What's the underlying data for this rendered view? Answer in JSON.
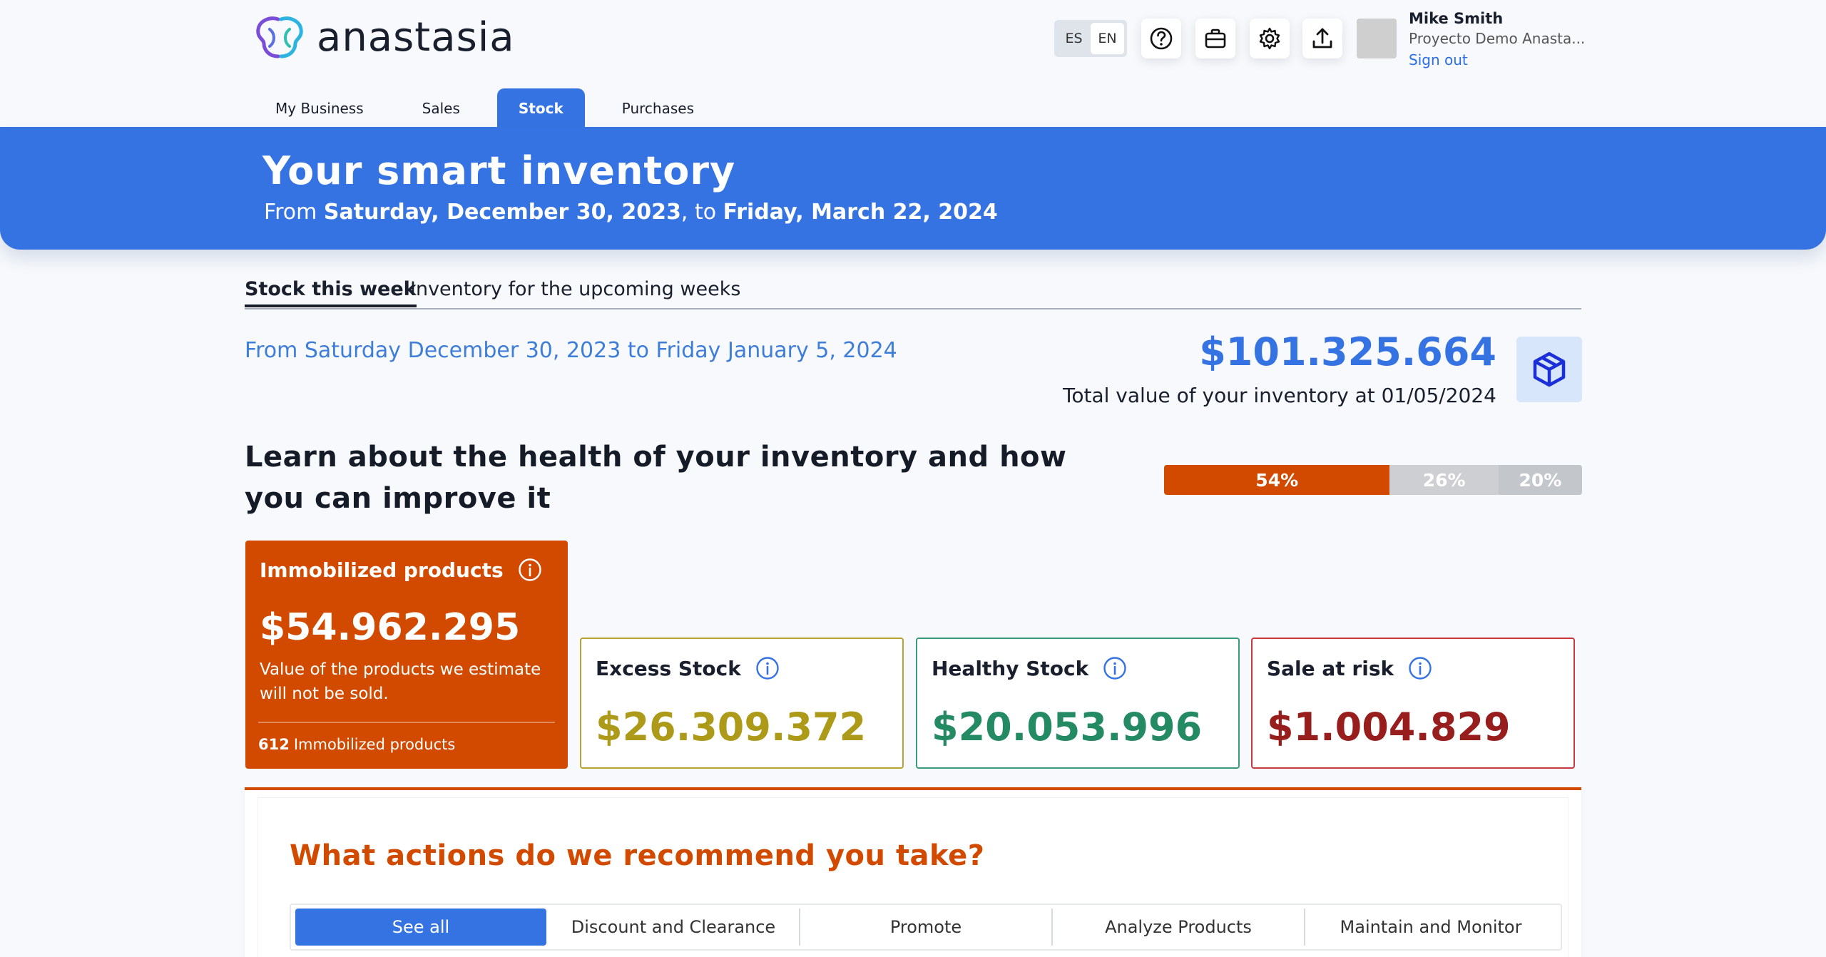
{
  "app": {
    "brand": "anastasia"
  },
  "header": {
    "lang_es": "ES",
    "lang_en": "EN",
    "user_name": "Mike Smith",
    "user_org": "Proyecto Demo Anasta...",
    "sign_out": "Sign out"
  },
  "nav": {
    "tabs": [
      "My Business",
      "Sales",
      "Stock",
      "Purchases"
    ],
    "active_tab": "Stock"
  },
  "banner": {
    "title": "Your smart inventory",
    "from_label": "From",
    "start_date": "Saturday, December 30, 2023",
    "to_label": ", to",
    "end_date": "Friday, March 22, 2024"
  },
  "subtabs": {
    "active": "Stock this week",
    "other": "Inventory for the upcoming weeks"
  },
  "summary": {
    "range_from": "From Saturday December 30, 2023",
    "range_to": "to",
    "range_end": "Friday January 5, 2024",
    "total_value": "$101.325.664",
    "total_label": "Total value of your inventory at 01/05/2024"
  },
  "health": {
    "title": "Learn about the health of your inventory and how you can improve it",
    "bar": [
      {
        "label": "54%",
        "value": 54,
        "color": "#d24a00"
      },
      {
        "label": "26%",
        "value": 26,
        "color": "#cdcfd3"
      },
      {
        "label": "20%",
        "value": 20,
        "color": "#c3c6cb"
      }
    ]
  },
  "cards": {
    "immobilized": {
      "title": "Immobilized products",
      "value": "$54.962.295",
      "description": "Value of the products we estimate will not be sold.",
      "count": "612",
      "count_label": "Immobilized products"
    },
    "excess": {
      "title": "Excess Stock",
      "value": "$26.309.372"
    },
    "healthy": {
      "title": "Healthy Stock",
      "value": "$20.053.996"
    },
    "risk": {
      "title": "Sale at risk",
      "value": "$1.004.829"
    }
  },
  "actions": {
    "title": "What actions do we recommend you take?",
    "filters": [
      "See all",
      "Discount and Clearance",
      "Promote",
      "Analyze Products",
      "Maintain and Monitor"
    ]
  },
  "colors": {
    "primary": "#3573e2",
    "immobilized": "#d24a00",
    "excess": "#ad9a18",
    "healthy": "#238a64",
    "risk": "#981d1d"
  }
}
